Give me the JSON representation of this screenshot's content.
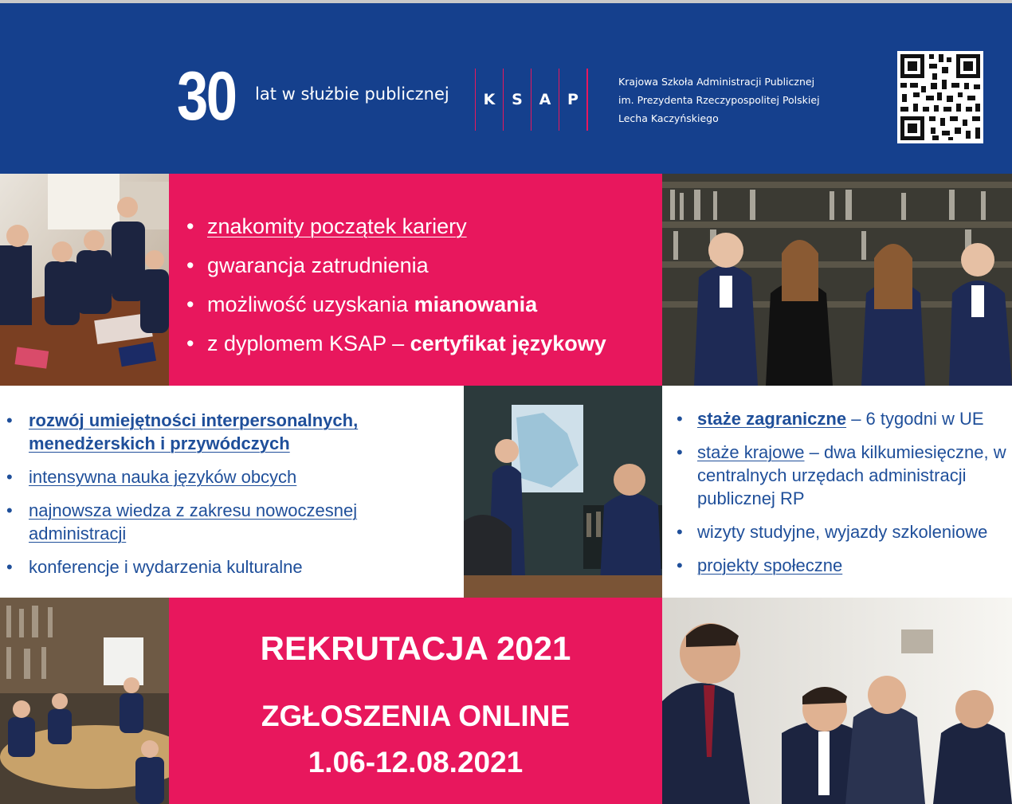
{
  "colors": {
    "navy": "#15408d",
    "accent": "#e8175d",
    "link_blue": "#1f4f9a"
  },
  "header": {
    "anniversary_number": "30",
    "tagline": "lat w służbie publicznej",
    "ksap_letters": [
      "K",
      "S",
      "A",
      "P"
    ],
    "institution_lines": [
      "Krajowa Szkoła Administracji Publicznej",
      "im. Prezydenta Rzeczypospolitej Polskiej",
      "Lecha Kaczyńskiego"
    ],
    "qr_icon": "qr-code-icon"
  },
  "benefits": {
    "item1": "znakomity początek kariery",
    "item2": "gwarancja zatrudnienia",
    "item3_text": "możliwość uzyskania ",
    "item3_bold": "mianowania",
    "item4_text": "z dyplomem KSAP – ",
    "item4_bold": "certyfikat językowy"
  },
  "studies": {
    "item1": "rozwój umiejętności interpersonalnych, menedżerskich i przywódczych",
    "item2": "intensywna nauka języków obcych",
    "item3": "najnowsza wiedza z zakresu nowoczesnej administracji",
    "item4": "konferencje i wydarzenia kulturalne"
  },
  "internships": {
    "item1_link": "staże zagraniczne",
    "item1_rest": " – 6 tygodni w UE",
    "item2_link": "staże krajowe",
    "item2_rest": " – dwa kilkumiesięczne, w centralnych urzędach administracji publicznej RP",
    "item3": "wizyty studyjne, wyjazdy szkoleniowe",
    "item4": "projekty społeczne"
  },
  "recruitment": {
    "title": "REKRUTACJA 2021",
    "line1": "ZGŁOSZENIA ONLINE",
    "line2": "1.06-12.08.2021"
  }
}
